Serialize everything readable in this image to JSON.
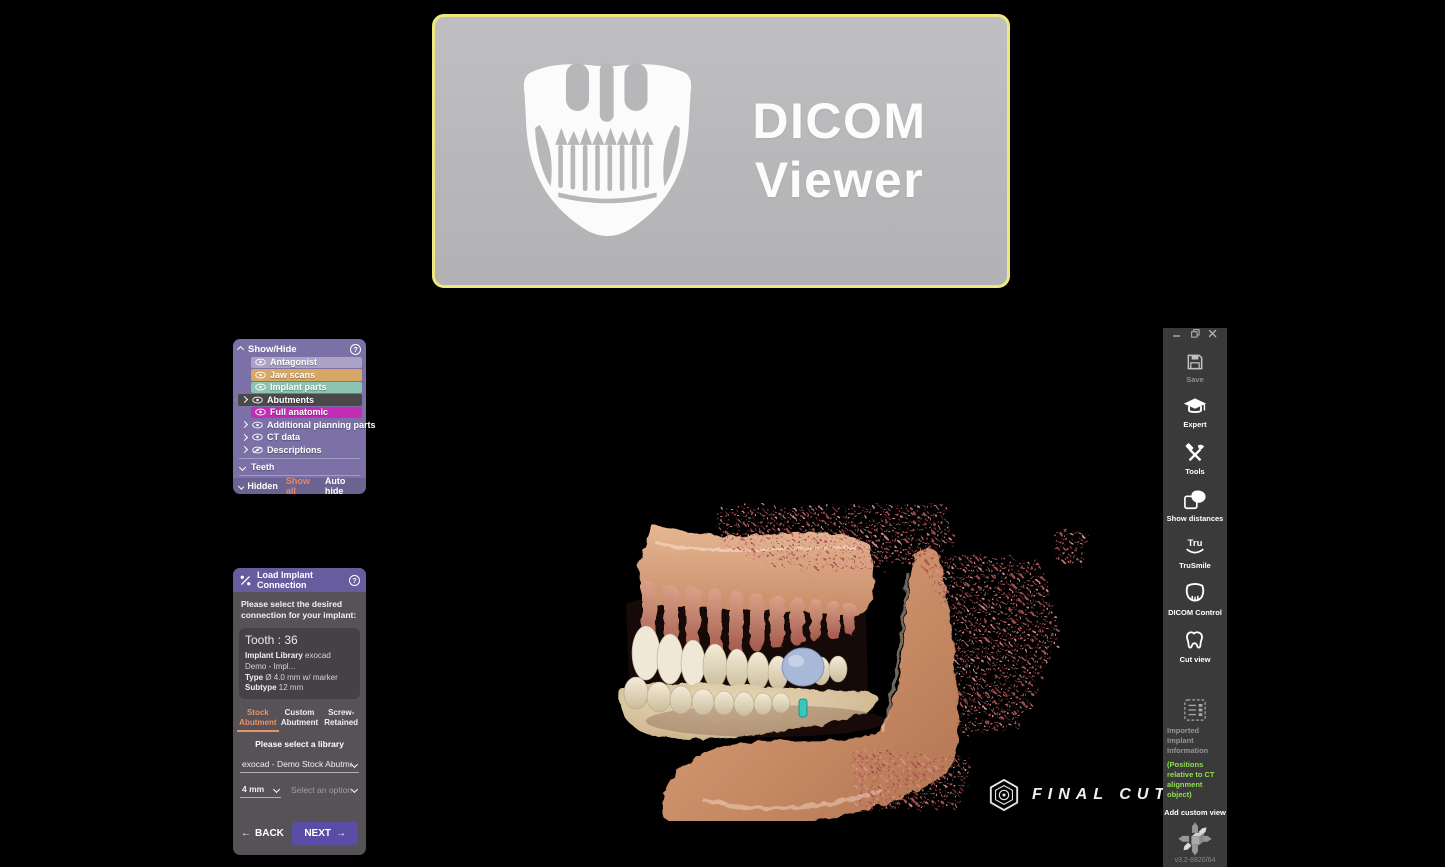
{
  "banner": {
    "title_line1": "DICOM",
    "title_line2": "Viewer"
  },
  "icons": {
    "help": "?",
    "back_arrow": "←",
    "next_arrow": "→"
  },
  "colors": {
    "banner_border": "#f0e87e",
    "panel_purple": "#7b71a6",
    "dialog_header_purple": "#675c9e",
    "next_button_purple": "#5a4da6",
    "active_tab_orange": "#e8926a",
    "show_all_orange": "#e98866",
    "note_green": "#8ede4f"
  },
  "show_hide": {
    "title": "Show/Hide",
    "help": "?",
    "items": [
      {
        "label": "Antagonist",
        "color": "#aba3c7",
        "has_expander": false,
        "visible": true
      },
      {
        "label": "Jaw scans",
        "color": "#d7a765",
        "has_expander": false,
        "visible": true
      },
      {
        "label": "Implant parts",
        "color": "#8cc3b2",
        "has_expander": false,
        "visible": true
      },
      {
        "label": "Abutments",
        "color": "#4b4849",
        "has_expander": true,
        "visible": true
      },
      {
        "label": "Full anatomic",
        "color": "#c32cb5",
        "has_expander": false,
        "visible": true
      },
      {
        "label": "Additional planning parts",
        "color": "",
        "has_expander": true,
        "visible": true
      },
      {
        "label": "CT data",
        "color": "",
        "has_expander": true,
        "visible": true
      },
      {
        "label": "Descriptions",
        "color": "",
        "has_expander": true,
        "visible": false
      }
    ],
    "teeth_label": "Teeth",
    "footer": {
      "hidden": "Hidden",
      "show_all": "Show all",
      "auto_hide": "Auto hide"
    }
  },
  "dialog": {
    "title": "Load Implant Connection",
    "help": "?",
    "instruction": "Please select the desired connection for your implant:",
    "info": {
      "tooth": "Tooth : 36",
      "library_label": "Implant Library",
      "library_value": "exocad Demo - Impl...",
      "type_label": "Type",
      "type_value": "Ø 4.0 mm w/ marker",
      "subtype_label": "Subtype",
      "subtype_value": "12 mm"
    },
    "tabs": [
      {
        "label": "Stock Abutment",
        "active": true
      },
      {
        "label": "Custom Abutment",
        "active": false
      },
      {
        "label": "Screw-Retained",
        "active": false
      }
    ],
    "library_prompt": "Please select a library",
    "dropdowns": {
      "library": "exocad - Demo Stock Abutment FD",
      "size": "4 mm",
      "option": "Select an option"
    },
    "back": "BACK",
    "next": "NEXT"
  },
  "watermark": {
    "text": "FINAL CUT"
  },
  "sidebar": {
    "buttons": [
      {
        "label": "Save",
        "icon": "save-icon",
        "disabled": true
      },
      {
        "label": "Expert",
        "icon": "expert-icon",
        "disabled": false
      },
      {
        "label": "Tools",
        "icon": "tools-icon",
        "disabled": false
      },
      {
        "label": "Show distances",
        "icon": "show-distances-icon",
        "disabled": false
      },
      {
        "label": "TruSmile",
        "icon": "trusmile-icon",
        "disabled": false
      },
      {
        "label": "DICOM Control",
        "icon": "dicom-control-icon",
        "disabled": false
      },
      {
        "label": "Cut view",
        "icon": "cut-view-icon",
        "disabled": false
      }
    ],
    "imported": {
      "title": "Imported Implant Information",
      "note": "(Positions relative to CT alignment object)"
    },
    "add_custom_view": "Add custom view",
    "version": "v3.2-8820/64"
  }
}
